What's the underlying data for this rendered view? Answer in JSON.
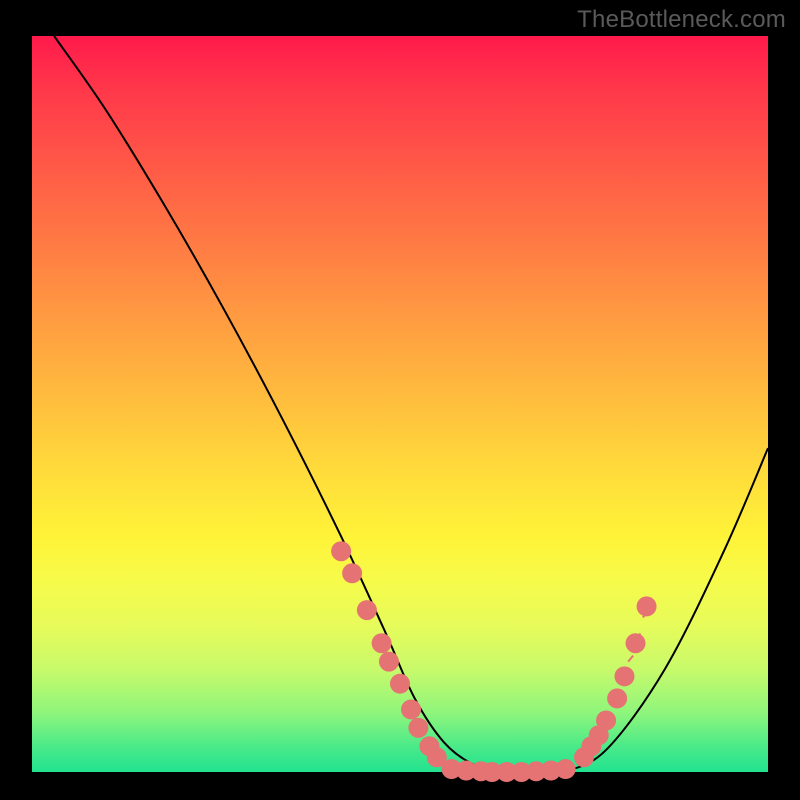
{
  "watermark": "TheBottleneck.com",
  "chart_data": {
    "type": "line",
    "title": "",
    "xlabel": "",
    "ylabel": "",
    "xlim": [
      0,
      100
    ],
    "ylim": [
      0,
      100
    ],
    "grid": false,
    "series": [
      {
        "name": "curve",
        "x": [
          3,
          10,
          18,
          26,
          34,
          42,
          48,
          52,
          56,
          60,
          64,
          68,
          72,
          78,
          86,
          94,
          100
        ],
        "values": [
          100,
          90,
          77,
          63,
          48,
          32,
          19,
          10,
          4,
          1,
          0,
          0,
          0,
          3,
          14,
          30,
          44
        ],
        "stroke": "#000000",
        "stroke_width": 2
      }
    ],
    "markers": [
      {
        "name": "left-descent-dots",
        "x": [
          42.0,
          43.5,
          45.5,
          47.5,
          48.5,
          50.0,
          51.5,
          52.5,
          54.0,
          55.0
        ],
        "values": [
          30.0,
          27.0,
          22.0,
          17.5,
          15.0,
          12.0,
          8.5,
          6.0,
          3.5,
          2.0
        ],
        "color": "#e57373",
        "radius": 10
      },
      {
        "name": "valley-dots",
        "x": [
          57.0,
          59.0,
          61.0,
          62.5,
          64.5,
          66.5,
          68.5,
          70.5,
          72.5
        ],
        "values": [
          0.4,
          0.2,
          0.1,
          0.0,
          0.0,
          0.0,
          0.1,
          0.2,
          0.4
        ],
        "color": "#e57373",
        "radius": 10
      },
      {
        "name": "right-ascent-dots",
        "x": [
          75.0,
          76.0,
          77.0,
          78.0,
          79.5,
          80.5,
          82.0,
          83.5
        ],
        "values": [
          2.0,
          3.5,
          5.0,
          7.0,
          10.0,
          13.0,
          17.5,
          22.5
        ],
        "color": "#e57373",
        "radius": 10
      },
      {
        "name": "right-ascent-ticks",
        "x": [
          76.0,
          77.0,
          78.0,
          79.0,
          80.0,
          81.0,
          82.0,
          83.0
        ],
        "values": [
          3.0,
          5.0,
          7.0,
          9.0,
          12.0,
          15.0,
          18.0,
          21.0
        ],
        "color": "#e57373",
        "radius": 2,
        "style": "tick"
      }
    ],
    "gradient_stops": [
      {
        "pos": 0,
        "color": "#ff1a4b"
      },
      {
        "pos": 8,
        "color": "#ff3a4a"
      },
      {
        "pos": 18,
        "color": "#ff5a47"
      },
      {
        "pos": 28,
        "color": "#ff7a44"
      },
      {
        "pos": 38,
        "color": "#ff9a41"
      },
      {
        "pos": 48,
        "color": "#ffb93e"
      },
      {
        "pos": 58,
        "color": "#ffd83b"
      },
      {
        "pos": 68,
        "color": "#fff338"
      },
      {
        "pos": 74,
        "color": "#f6fb4a"
      },
      {
        "pos": 80,
        "color": "#e7fb5a"
      },
      {
        "pos": 86,
        "color": "#c8fa6a"
      },
      {
        "pos": 92,
        "color": "#8ef57c"
      },
      {
        "pos": 97,
        "color": "#44e98a"
      },
      {
        "pos": 100,
        "color": "#22e28f"
      }
    ]
  }
}
